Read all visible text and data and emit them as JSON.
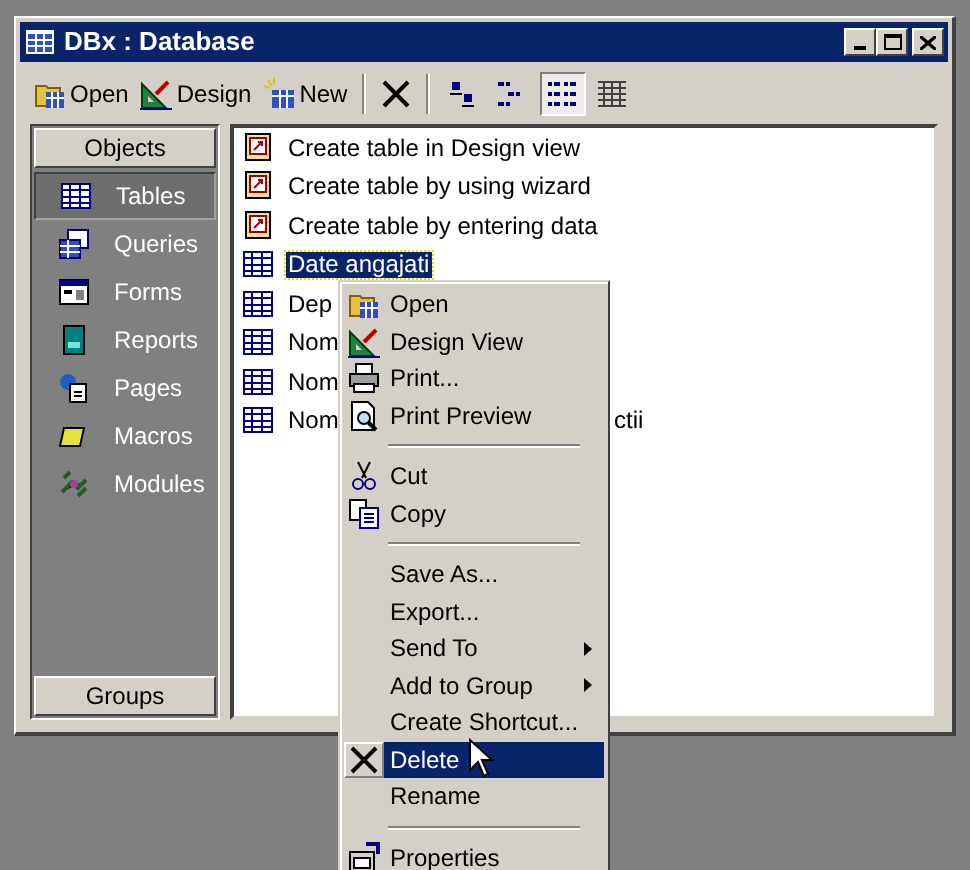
{
  "window": {
    "title": "DBx : Database"
  },
  "toolbar": [
    {
      "kind": "open",
      "label": "Open"
    },
    {
      "kind": "design",
      "label": "Design"
    },
    {
      "kind": "new",
      "label": "New"
    },
    {
      "kind": "delete"
    }
  ],
  "view_buttons": [
    {
      "kind": "large",
      "selected": false
    },
    {
      "kind": "small",
      "selected": false
    },
    {
      "kind": "list",
      "selected": true
    },
    {
      "kind": "details",
      "selected": false
    }
  ],
  "objects_button": "Objects",
  "objects": [
    {
      "kind": "table",
      "label": "Tables",
      "selected": true
    },
    {
      "kind": "query",
      "label": "Queries",
      "selected": false
    },
    {
      "kind": "form",
      "label": "Forms",
      "selected": false
    },
    {
      "kind": "report",
      "label": "Reports",
      "selected": false
    },
    {
      "kind": "page",
      "label": "Pages",
      "selected": false
    },
    {
      "kind": "macro",
      "label": "Macros",
      "selected": false
    },
    {
      "kind": "module",
      "label": "Modules",
      "selected": false
    }
  ],
  "groups_button": "Groups",
  "items": [
    {
      "kind": "shortcut",
      "text": "Create table in Design view",
      "selected": false
    },
    {
      "kind": "shortcut",
      "text": "Create table by using wizard",
      "selected": false
    },
    {
      "kind": "shortcut",
      "text": "Create table by entering data",
      "selected": false
    },
    {
      "kind": "table",
      "text": "Date angajati",
      "selected": true
    },
    {
      "kind": "table",
      "text": "Dep",
      "selected": false
    },
    {
      "kind": "table",
      "text": "Nom",
      "selected": false
    },
    {
      "kind": "table",
      "text": "Nom",
      "selected": false
    },
    {
      "kind": "table",
      "text": "Nom",
      "tail": "ctii",
      "selected": false
    }
  ],
  "context_menu": [
    {
      "kind": "open",
      "label": "Open",
      "selected": false
    },
    {
      "kind": "design",
      "label": "Design View",
      "selected": false
    },
    {
      "kind": "print",
      "label": "Print...",
      "selected": false
    },
    {
      "kind": "preview",
      "label": "Print Preview",
      "selected": false
    },
    {
      "kind": "separator"
    },
    {
      "kind": "cut",
      "label": "Cut",
      "selected": false
    },
    {
      "kind": "copy",
      "label": "Copy",
      "selected": false
    },
    {
      "kind": "separator"
    },
    {
      "kind": "item",
      "label": "Save As...",
      "selected": false
    },
    {
      "kind": "item",
      "label": "Export...",
      "selected": false
    },
    {
      "kind": "item",
      "label": "Send To",
      "submenu": true,
      "selected": false
    },
    {
      "kind": "item",
      "label": "Add to Group",
      "submenu": true,
      "selected": false
    },
    {
      "kind": "item",
      "label": "Create Shortcut...",
      "selected": false
    },
    {
      "kind": "delete",
      "label": "Delete",
      "selected": true
    },
    {
      "kind": "item",
      "label": "Rename",
      "selected": false
    },
    {
      "kind": "separator"
    },
    {
      "kind": "properties",
      "label": "Properties",
      "selected": false
    }
  ]
}
